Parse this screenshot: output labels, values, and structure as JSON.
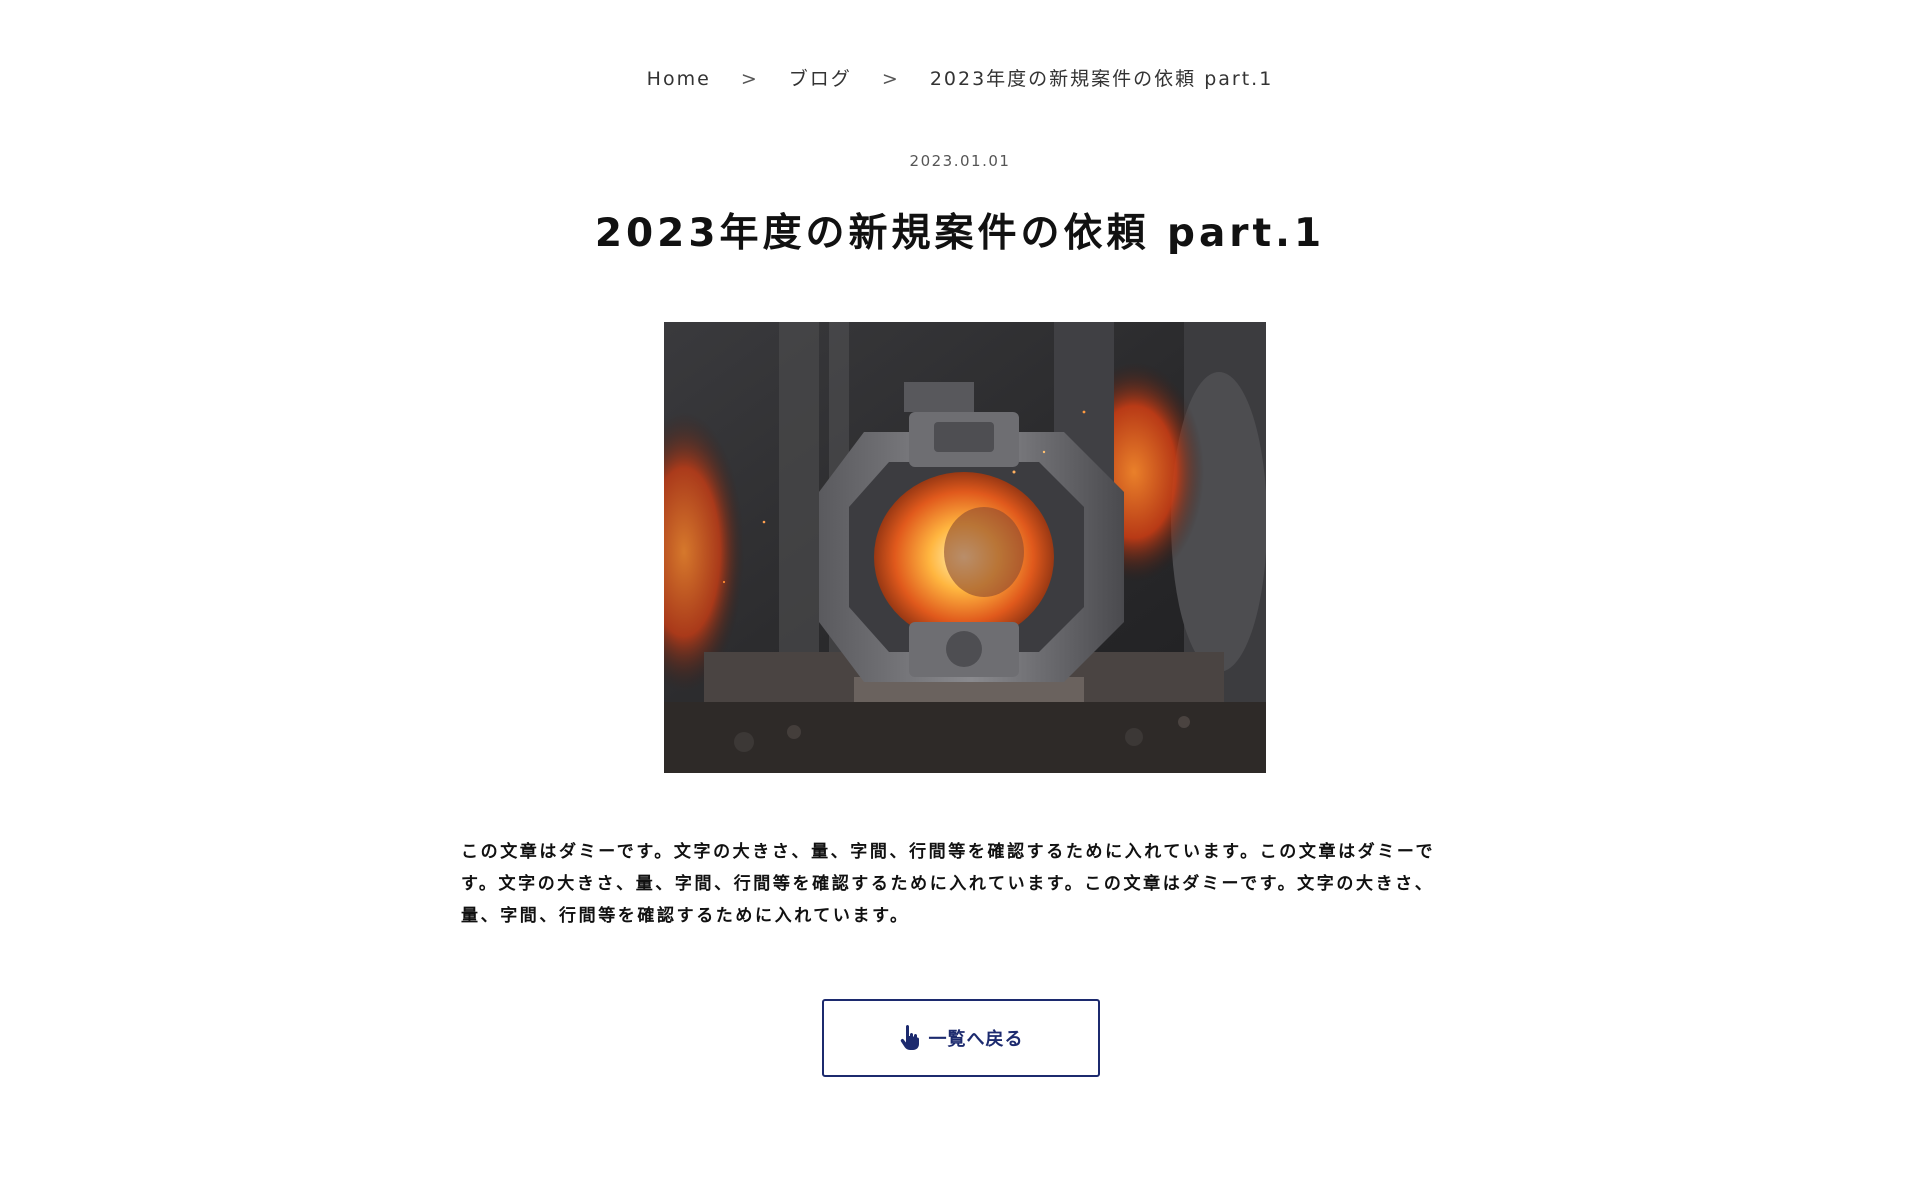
{
  "breadcrumb": {
    "home": "Home",
    "separator": ">",
    "blog": "ブログ",
    "current": "2023年度の新規案件の依頼 part.1"
  },
  "article": {
    "date": "2023.01.01",
    "title": "2023年度の新規案件の依頼 part.1",
    "image_alt": "Molten metal in an industrial forge casting mold",
    "body": "この文章はダミーです。文字の大きさ、量、字間、行間等を確認するために入れています。この文章はダミーです。文字の大きさ、量、字間、行間等を確認するために入れています。この文章はダミーです。文字の大きさ、量、字間、行間等を確認するために入れています。"
  },
  "back_button": {
    "label": "一覧へ戻る",
    "icon": "pointer-hand-icon"
  },
  "colors": {
    "accent": "#1c2a6e",
    "text": "#111111",
    "background": "#ffffff"
  }
}
